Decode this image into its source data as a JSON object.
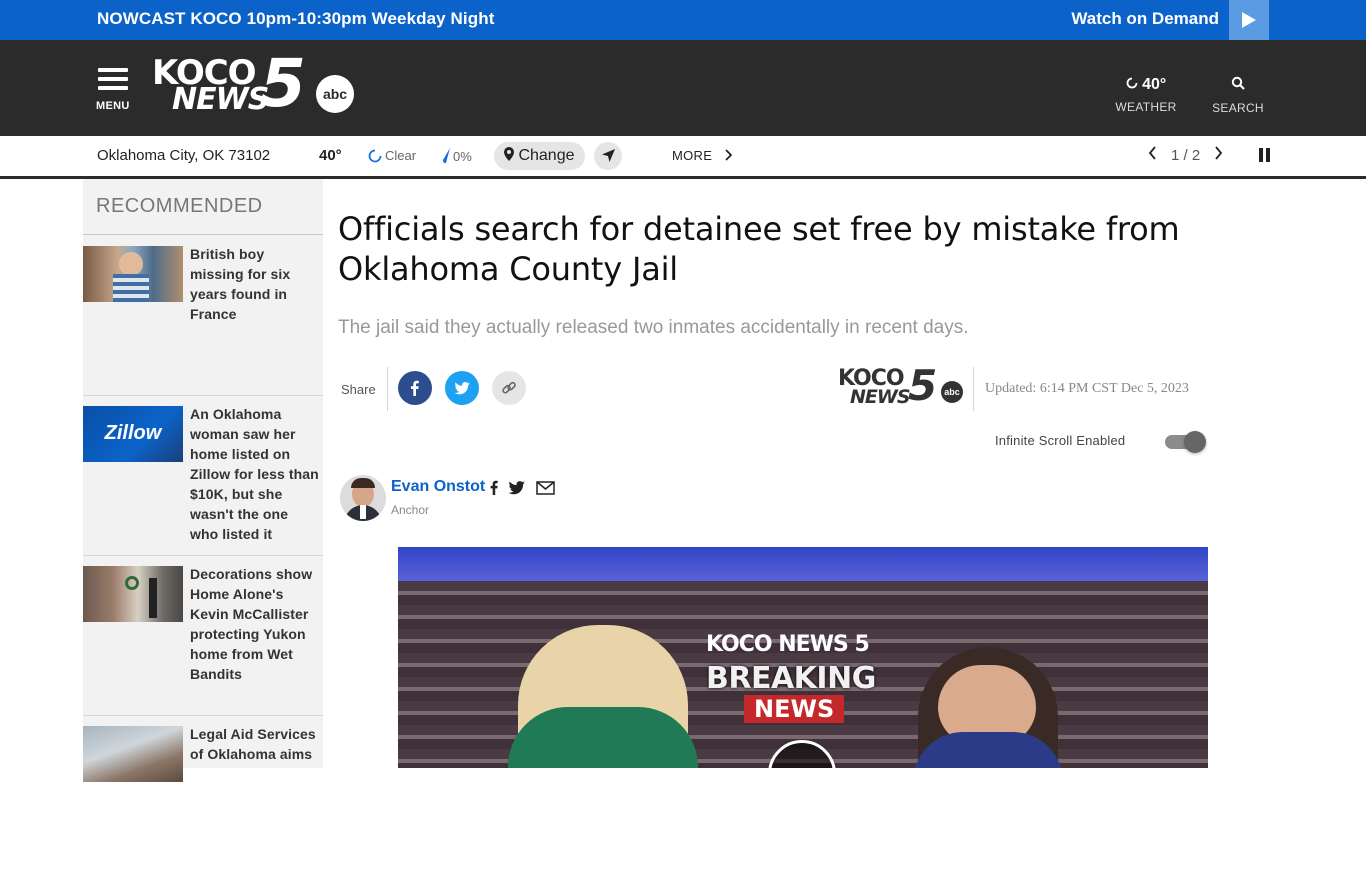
{
  "promo": {
    "left_text": "NOWCAST KOCO 10pm-10:30pm Weekday Night",
    "right_text": "Watch on Demand"
  },
  "header": {
    "menu_label": "MENU",
    "logo": {
      "koco": "KOCO",
      "news": "NEWS",
      "five": "5",
      "abc": "abc"
    },
    "weather_temp": "40°",
    "weather_label": "WEATHER",
    "search_label": "SEARCH"
  },
  "weather_strip": {
    "location": "Oklahoma City, OK 73102",
    "temp": "40°",
    "condition": "Clear",
    "precip": "0%",
    "change_label": "Change",
    "more_label": "MORE",
    "pager": "1 / 2"
  },
  "sidebar": {
    "title": "RECOMMENDED",
    "items": [
      {
        "headline": "British boy missing for six years found in France"
      },
      {
        "headline": "An Oklahoma woman saw her home listed on Zillow for less than $10K, but she wasn't the one who listed it",
        "thumb_text": "Zillow"
      },
      {
        "headline": "Decorations show Home Alone's Kevin McCallister protecting Yukon home from Wet Bandits"
      },
      {
        "headline": "Legal Aid Services of Oklahoma aims"
      }
    ]
  },
  "article": {
    "headline": "Officials search for detainee set free by mistake from Oklahoma County Jail",
    "dek": "The jail said they actually released two inmates accidentally in recent days.",
    "share_label": "Share",
    "updated": "Updated: 6:14 PM CST Dec 5, 2023",
    "infinite_scroll_label": "Infinite Scroll Enabled",
    "author": {
      "name": "Evan Onstot",
      "role": "Anchor"
    },
    "video": {
      "brand_koco": "KOCO NEWS 5",
      "brand_breaking": "BREAKING",
      "brand_news": "NEWS"
    }
  },
  "colors": {
    "promo_blue": "#0b63c9",
    "header_dark": "#2b2b2b",
    "link_blue": "#0b63c9",
    "facebook": "#2c4d8e",
    "twitter": "#1da1f2"
  }
}
